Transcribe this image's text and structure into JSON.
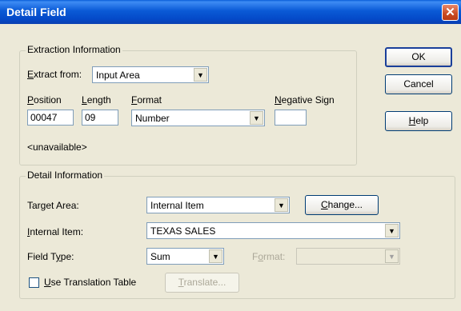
{
  "window": {
    "title": "Detail Field",
    "close_glyph": "✕"
  },
  "extraction": {
    "legend": "Extraction Information",
    "extract_from": {
      "label_u": "E",
      "label_rest": "xtract from:",
      "value": "Input Area"
    },
    "position": {
      "label_u": "P",
      "label_rest": "osition",
      "value": "00047"
    },
    "length": {
      "label_u": "L",
      "label_rest": "ength",
      "value": "09"
    },
    "format": {
      "label_u": "F",
      "label_rest": "ormat",
      "value": "Number"
    },
    "negative_sign": {
      "label_u": "N",
      "label_rest": "egative Sign",
      "value": ""
    },
    "status": "<unavailable>"
  },
  "detail": {
    "legend": "Detail Information",
    "target_area": {
      "label": "Target Area:",
      "value": "Internal Item"
    },
    "change_button": {
      "label_u": "C",
      "label_rest": "hange..."
    },
    "internal_item": {
      "label_u": "I",
      "label_rest": "nternal Item:",
      "value": "TEXAS SALES"
    },
    "field_type": {
      "label_pre": "Field T",
      "label_u": "y",
      "label_rest": "pe:",
      "value": "Sum"
    },
    "format": {
      "label_pre": "F",
      "label_u": "o",
      "label_rest": "rmat:",
      "value": ""
    },
    "translation_table": {
      "label_u": "U",
      "label_rest": "se Translation Table",
      "checked": false
    },
    "translate_button": {
      "label_u": "T",
      "label_rest": "ranslate..."
    }
  },
  "buttons": {
    "ok": "OK",
    "cancel": "Cancel",
    "help": {
      "label_u": "H",
      "label_rest": "elp"
    }
  },
  "icons": {
    "dropdown": "▼",
    "close": "close-icon"
  }
}
